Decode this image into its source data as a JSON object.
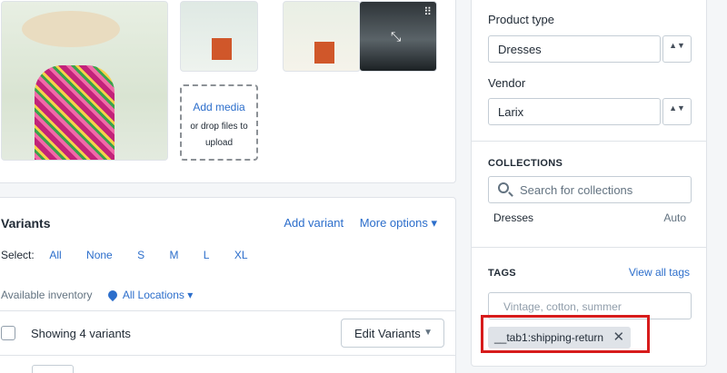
{
  "media": {
    "add_media_link": "Add media",
    "add_media_hint": "or drop files to upload",
    "drag_handle_glyph": "⠿",
    "expand_glyph": "⤡"
  },
  "variants": {
    "title": "Variants",
    "add_variant": "Add variant",
    "more_options": "More options ▾",
    "select_label": "Select:",
    "select_options": [
      "All",
      "None",
      "S",
      "M",
      "L",
      "XL"
    ],
    "inventory_label": "Available inventory",
    "location": "All Locations ▾",
    "showing": "Showing 4 variants",
    "edit_button": "Edit Variants",
    "edit_caret": "▼"
  },
  "sidebar": {
    "product_type_label": "Product type",
    "product_type_value": "Dresses",
    "vendor_label": "Vendor",
    "vendor_value": "Larix",
    "stepper_glyph": "▲▼",
    "collections_heading": "COLLECTIONS",
    "collections_search_placeholder": "Search for collections",
    "collection_name": "Dresses",
    "collection_type": "Auto",
    "tags_heading": "TAGS",
    "view_all_tags": "View all tags",
    "tags_placeholder": "Vintage, cotton, summer",
    "tag_value": "__tab1:shipping-return",
    "tag_remove": "✕"
  },
  "colors": {
    "link": "#2c6ecb",
    "highlight": "#d71c1c",
    "tag_bg": "#dfe3e8"
  }
}
